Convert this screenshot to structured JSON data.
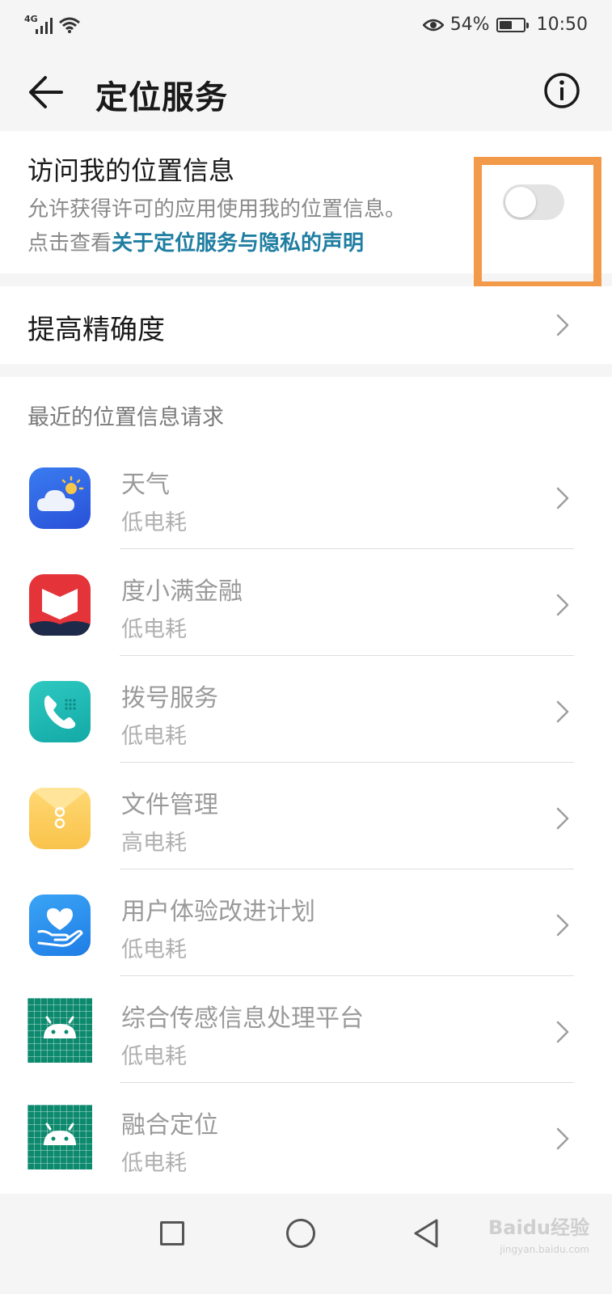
{
  "status_bar": {
    "network": "4G",
    "battery_percent": "54%",
    "battery_level": 0.54,
    "time": "10:50",
    "icons": [
      "signal-icon",
      "wifi-icon",
      "eye-icon",
      "battery-icon"
    ]
  },
  "header": {
    "title": "定位服务",
    "back_icon": "back-arrow-icon",
    "info_icon": "info-icon"
  },
  "location_access": {
    "title": "访问我的位置信息",
    "description": "允许获得许可的应用使用我的位置信息。",
    "link_prefix": "点击查看",
    "link_text": "关于定位服务与隐私的声明",
    "toggle_on": false
  },
  "accuracy": {
    "label": "提高精确度"
  },
  "recent_requests": {
    "header": "最近的位置信息请求",
    "apps": [
      {
        "name": "天气",
        "power": "低电耗",
        "icon": "weather-icon"
      },
      {
        "name": "度小满金融",
        "power": "低电耗",
        "icon": "duxiaoman-icon"
      },
      {
        "name": "拨号服务",
        "power": "低电耗",
        "icon": "phone-icon"
      },
      {
        "name": "文件管理",
        "power": "高电耗",
        "icon": "file-manager-icon"
      },
      {
        "name": "用户体验改进计划",
        "power": "低电耗",
        "icon": "heart-hand-icon"
      },
      {
        "name": "综合传感信息处理平台",
        "power": "低电耗",
        "icon": "android-icon"
      },
      {
        "name": "融合定位",
        "power": "低电耗",
        "icon": "android-icon"
      }
    ]
  },
  "nav_bar": {
    "icons": [
      "recent-apps-icon",
      "home-icon",
      "back-icon"
    ]
  },
  "watermark": {
    "text": "Baidu经验",
    "sub": "jingyan.baidu.com"
  },
  "colors": {
    "link": "#1f7ea1",
    "highlight": "#f29a4a",
    "background": "#f5f5f5"
  }
}
